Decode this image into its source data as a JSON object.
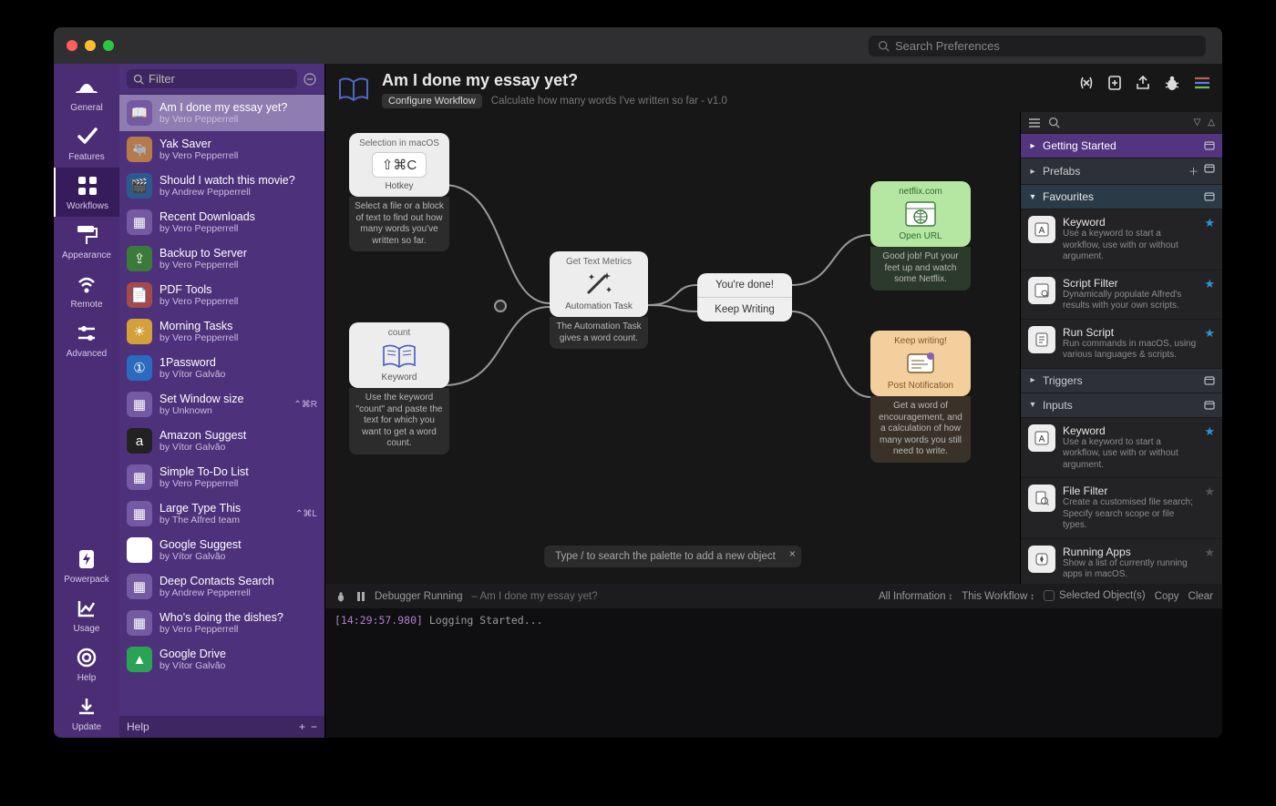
{
  "titlebar": {
    "search_placeholder": "Search Preferences"
  },
  "nav": {
    "items": [
      {
        "label": "General",
        "icon": "hat"
      },
      {
        "label": "Features",
        "icon": "check"
      },
      {
        "label": "Workflows",
        "icon": "grid",
        "active": true
      },
      {
        "label": "Appearance",
        "icon": "roller"
      },
      {
        "label": "Remote",
        "icon": "remote"
      },
      {
        "label": "Advanced",
        "icon": "sliders"
      }
    ],
    "bottom": [
      {
        "label": "Powerpack",
        "icon": "bolt"
      },
      {
        "label": "Usage",
        "icon": "chart"
      },
      {
        "label": "Help",
        "icon": "help"
      },
      {
        "label": "Update",
        "icon": "download"
      }
    ]
  },
  "workflows": {
    "filter_placeholder": "Filter",
    "items": [
      {
        "title": "Am I done my essay yet?",
        "by": "by Vero Pepperrell",
        "selected": true
      },
      {
        "title": "Yak Saver",
        "by": "by Vero Pepperrell"
      },
      {
        "title": "Should I watch this movie?",
        "by": "by Andrew Pepperrell"
      },
      {
        "title": "Recent Downloads",
        "by": "by Vero Pepperrell"
      },
      {
        "title": "Backup to Server",
        "by": "by Vero Pepperrell"
      },
      {
        "title": "PDF Tools",
        "by": "by Vero Pepperrell"
      },
      {
        "title": "Morning Tasks",
        "by": "by Vero Pepperrell"
      },
      {
        "title": "1Password",
        "by": "by Vítor Galvão"
      },
      {
        "title": "Set Window size",
        "by": "by Unknown",
        "shortcut": "⌃⌘R"
      },
      {
        "title": "Amazon Suggest",
        "by": "by Vítor Galvão"
      },
      {
        "title": "Simple To-Do List",
        "by": "by Vero Pepperrell"
      },
      {
        "title": "Large Type This",
        "by": "by The Alfred team",
        "shortcut": "⌃⌘L"
      },
      {
        "title": "Google Suggest",
        "by": "by Vítor Galvão"
      },
      {
        "title": "Deep Contacts Search",
        "by": "by Andrew Pepperrell"
      },
      {
        "title": "Who's doing the dishes?",
        "by": "by Vero Pepperrell"
      },
      {
        "title": "Google Drive",
        "by": "by Vítor Galvão"
      }
    ],
    "footer": {
      "help": "Help",
      "plus": "+",
      "minus": "−"
    }
  },
  "header": {
    "title": "Am I done my essay yet?",
    "configure": "Configure Workflow",
    "subtitle": "Calculate how many words I've written so far - v1.0"
  },
  "canvas": {
    "hotkey": {
      "top": "Selection in macOS",
      "keys": "⇧⌘C",
      "bottom": "Hotkey",
      "note": "Select a file or a block of text to find out how many words you've written so far."
    },
    "keyword": {
      "top": "count",
      "bottom": "Keyword",
      "note": "Use the keyword \"count\" and paste the text for which you want to get a word count."
    },
    "task": {
      "top": "Get Text Metrics",
      "bottom": "Automation Task",
      "note": "The Automation Task gives a word count."
    },
    "branches": {
      "opt1": "You're done!",
      "opt2": "Keep Writing"
    },
    "openurl": {
      "top": "netflix.com",
      "bottom": "Open URL",
      "note": "Good job! Put your feet up and watch some Netflix."
    },
    "notify": {
      "top": "Keep writing!",
      "bottom": "Post Notification",
      "note": "Get a word of encouragement, and a calculation of how many words you still need to write."
    },
    "hint": "Type / to search the palette to add a new object"
  },
  "palette": {
    "groups": [
      {
        "label": "Getting Started",
        "style": "purple",
        "open": false
      },
      {
        "label": "Prefabs",
        "style": "dark",
        "open": false,
        "plus": true
      },
      {
        "label": "Favourites",
        "style": "blue",
        "open": true,
        "items": [
          {
            "title": "Keyword",
            "desc": "Use a keyword to start a workflow, use with or without argument.",
            "star": true
          },
          {
            "title": "Script Filter",
            "desc": "Dynamically populate Alfred's results with your own scripts.",
            "star": true
          },
          {
            "title": "Run Script",
            "desc": "Run commands in macOS, using various languages & scripts.",
            "star": true
          }
        ]
      },
      {
        "label": "Triggers",
        "style": "dark",
        "open": false
      },
      {
        "label": "Inputs",
        "style": "dark",
        "open": true,
        "items": [
          {
            "title": "Keyword",
            "desc": "Use a keyword to start a workflow, use with or without argument.",
            "star": true
          },
          {
            "title": "File Filter",
            "desc": "Create a customised file search; Specify search scope or file types.",
            "star": false
          },
          {
            "title": "Running Apps",
            "desc": "Show a list of currently running apps in macOS.",
            "star": false
          }
        ]
      }
    ]
  },
  "debugger": {
    "status": "Debugger Running",
    "name": "Am I done my essay yet?",
    "info": "All Information",
    "scope": "This Workflow",
    "selected": "Selected Object(s)",
    "copy": "Copy",
    "clear": "Clear",
    "log_ts": "[14:29:57.980]",
    "log_msg": "Logging Started..."
  }
}
